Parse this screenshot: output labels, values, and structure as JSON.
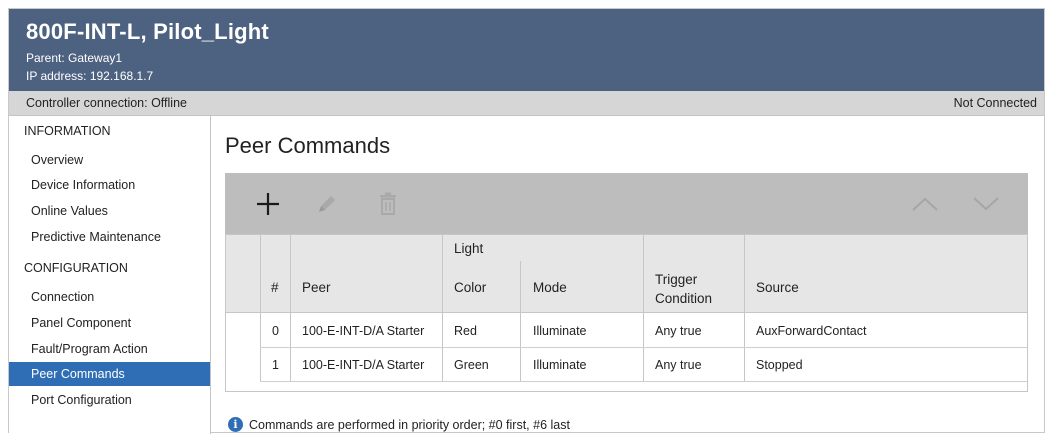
{
  "header": {
    "title": "800F-INT-L, Pilot_Light",
    "parent": "Parent:  Gateway1",
    "ip": "IP address:  192.168.1.7"
  },
  "status": {
    "connection": "Controller connection: Offline",
    "state": "Not Connected"
  },
  "sidebar": {
    "sections": [
      {
        "title": "INFORMATION",
        "items": [
          {
            "label": "Overview"
          },
          {
            "label": "Device Information"
          },
          {
            "label": "Online Values"
          },
          {
            "label": "Predictive Maintenance"
          }
        ]
      },
      {
        "title": "CONFIGURATION",
        "items": [
          {
            "label": "Connection"
          },
          {
            "label": "Panel Component"
          },
          {
            "label": "Fault/Program Action"
          },
          {
            "label": "Peer Commands",
            "active": true
          },
          {
            "label": "Port Configuration"
          }
        ]
      }
    ]
  },
  "main": {
    "title": "Peer Commands",
    "toolbar": {
      "icons": [
        "add-icon",
        "edit-icon",
        "delete-icon",
        "move-up-icon",
        "move-down-icon"
      ]
    },
    "table": {
      "group_header": "Light",
      "columns": [
        "#",
        "Peer",
        "Color",
        "Mode",
        "Trigger\nCondition",
        "Source"
      ],
      "rows": [
        {
          "num": "0",
          "peer": "100-E-INT-D/A Starter",
          "color": "Red",
          "mode": "Illuminate",
          "trigger": "Any true",
          "source": "AuxForwardContact"
        },
        {
          "num": "1",
          "peer": "100-E-INT-D/A Starter",
          "color": "Green",
          "mode": "Illuminate",
          "trigger": "Any true",
          "source": "Stopped"
        }
      ]
    },
    "note": "Commands are performed in priority order; #0 first, #6 last"
  },
  "colors": {
    "header_bg": "#4d6181",
    "accent": "#2f6db5",
    "toolbar_bg": "#bdbdbd"
  }
}
